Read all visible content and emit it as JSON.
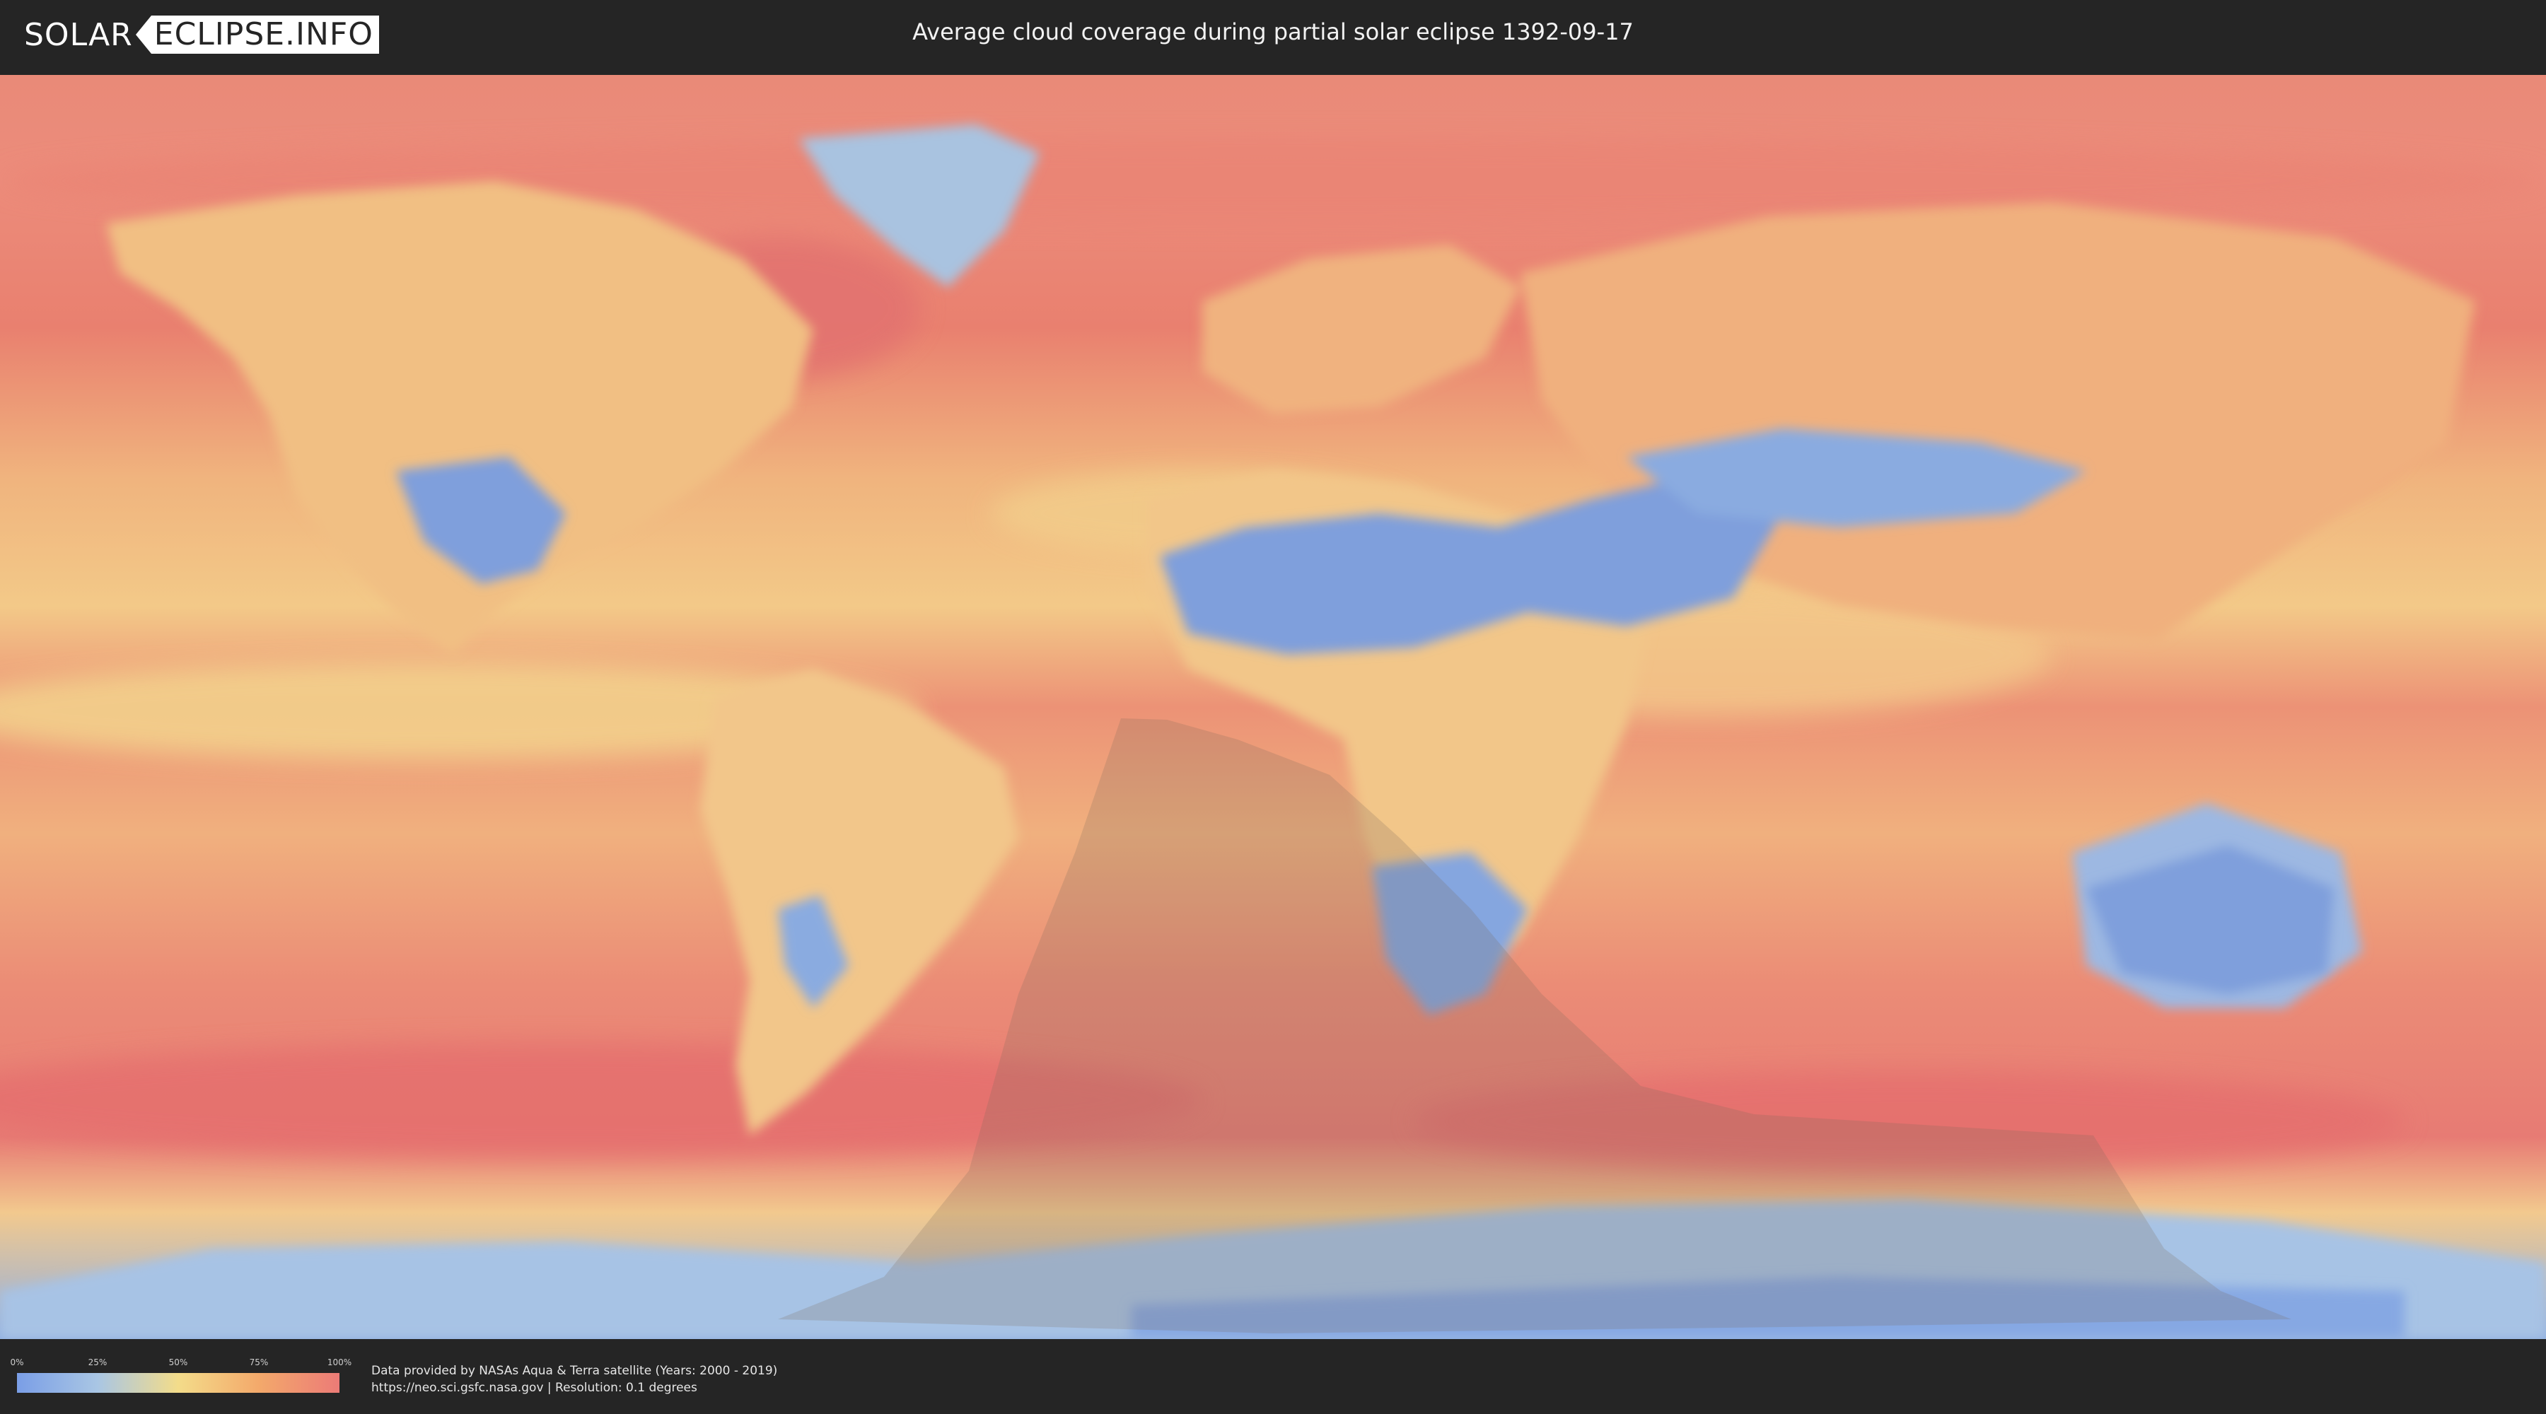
{
  "header": {
    "logo_left": "SOLAR",
    "logo_right": "ECLIPSE.INFO",
    "title": "Average cloud coverage during partial solar eclipse 1392-09-17"
  },
  "legend": {
    "ticks": [
      "0%",
      "25%",
      "50%",
      "75%",
      "100%"
    ],
    "colors": [
      "#7a9ee6",
      "#a9c6e4",
      "#f3dc8a",
      "#f3a96b",
      "#ec7b77"
    ]
  },
  "credits": {
    "line1": "Data provided by NASAs Aqua & Terra satellite (Years: 2000 - 2019)",
    "line2": "https://neo.sci.gsfc.nasa.gov | Resolution: 0.1 degrees"
  },
  "map": {
    "projection": "equirectangular",
    "layer": "average cloud coverage",
    "overlay": "partial eclipse visibility zone"
  }
}
